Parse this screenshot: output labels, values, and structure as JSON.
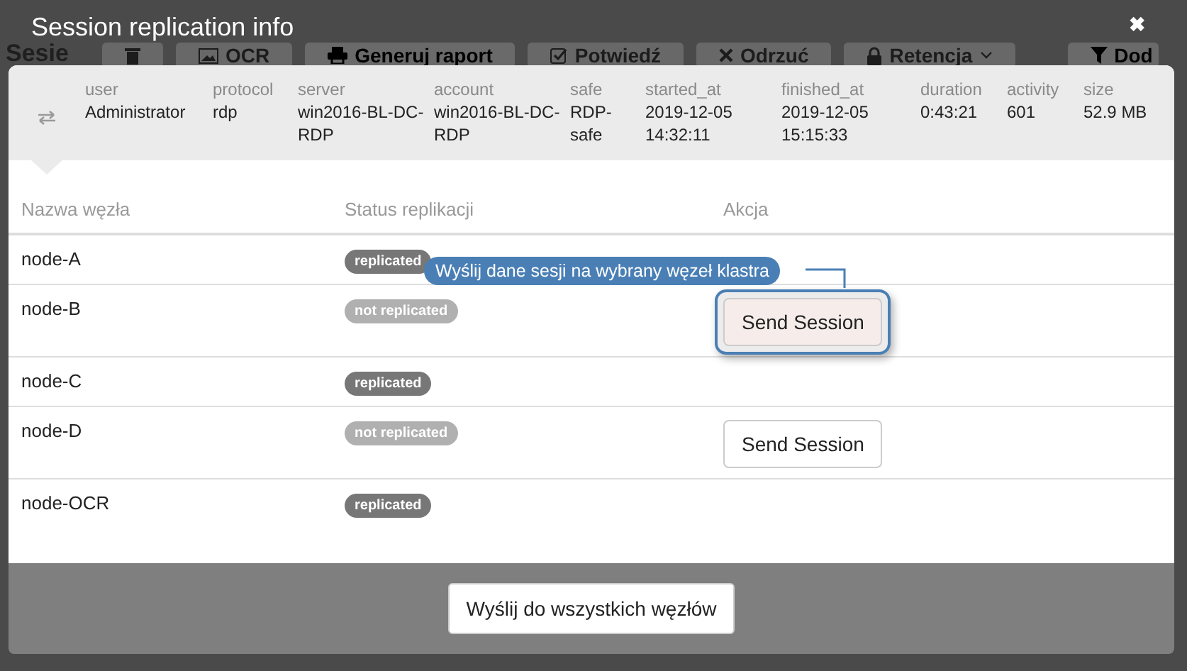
{
  "background": {
    "title": "Sesie",
    "toolbar": [
      {
        "kind": "trash",
        "disabled": true,
        "dropdown": false
      },
      {
        "kind": "image",
        "label": "OCR",
        "disabled": true,
        "dropdown": false
      },
      {
        "kind": "print",
        "label": "Generuj raport",
        "disabled": false,
        "dropdown": false
      },
      {
        "kind": "check",
        "label": "Potwiedź",
        "disabled": true,
        "dropdown": false
      },
      {
        "kind": "times",
        "label": "Odrzuć",
        "disabled": true,
        "dropdown": false
      },
      {
        "kind": "lock",
        "label": "Retencja",
        "disabled": true,
        "dropdown": true
      },
      {
        "kind": "filter",
        "label": "Dod",
        "disabled": false,
        "dropdown": false
      }
    ]
  },
  "modal": {
    "title": "Session replication info",
    "close": "✖",
    "session": [
      {
        "label": "user",
        "value": "Administrator"
      },
      {
        "label": "protocol",
        "value": "rdp"
      },
      {
        "label": "server",
        "value": "win2016-BL-DC-RDP"
      },
      {
        "label": "account",
        "value": "win2016-BL-DC-RDP"
      },
      {
        "label": "safe",
        "value": "RDP-safe"
      },
      {
        "label": "started_at",
        "value": "2019-12-05 14:32:11"
      },
      {
        "label": "finished_at",
        "value": "2019-12-05 15:15:33"
      },
      {
        "label": "duration",
        "value": "0:43:21"
      },
      {
        "label": "activity",
        "value": "601"
      },
      {
        "label": "size",
        "value": "52.9 MB"
      }
    ],
    "table": {
      "columns": [
        "Nazwa węzła",
        "Status replikacji",
        "Akcja"
      ],
      "rows": [
        {
          "name": "node-A",
          "status": {
            "label": "replicated",
            "replicated": true
          }
        },
        {
          "name": "node-B",
          "status": {
            "label": "not replicated",
            "replicated": false
          },
          "action": {
            "label": "Send Session",
            "highlighted": true,
            "tooltip": "Wyślij dane sesji na wybrany węzeł klastra"
          }
        },
        {
          "name": "node-C",
          "status": {
            "label": "replicated",
            "replicated": true
          }
        },
        {
          "name": "node-D",
          "status": {
            "label": "not replicated",
            "replicated": false
          },
          "action": {
            "label": "Send Session",
            "highlighted": false
          }
        },
        {
          "name": "node-OCR",
          "status": {
            "label": "replicated",
            "replicated": true
          }
        }
      ]
    },
    "footer_button": "Wyślij do wszystkich węzłów"
  }
}
